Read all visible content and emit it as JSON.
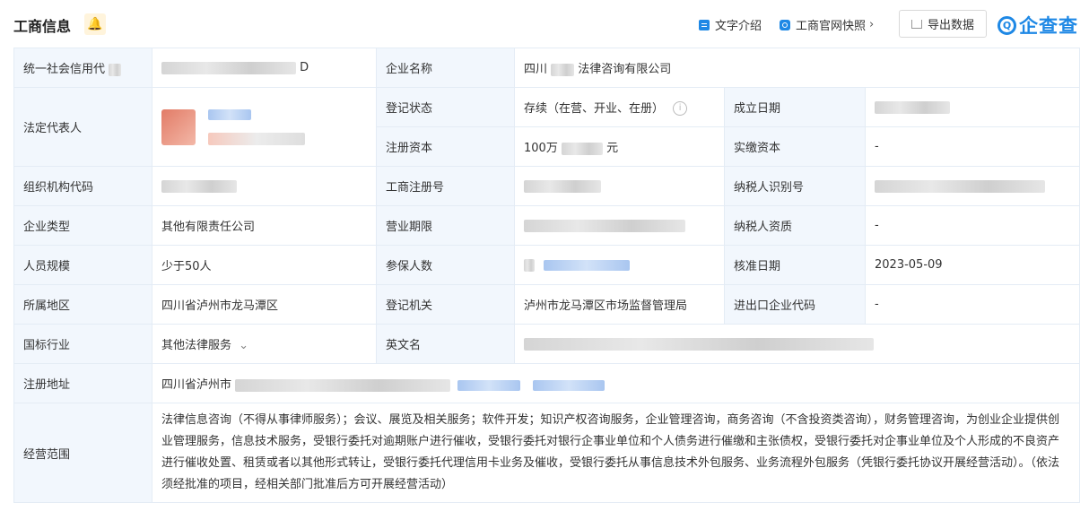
{
  "header": {
    "title": "工商信息",
    "text_intro": "文字介绍",
    "snapshot": "工商官网快照",
    "export": "导出数据",
    "logo_text": "企查查"
  },
  "colors": {
    "accent": "#1e88e5",
    "label_bg": "#f2f7fd",
    "border": "#e4ecf5"
  },
  "rows": {
    "credit_code_label": "统一社会信用代",
    "credit_code_value": "D",
    "company_name_label": "企业名称",
    "company_name_prefix": "四川",
    "company_name_suffix": "法律咨询有限公司",
    "legal_rep_label": "法定代表人",
    "reg_status_label": "登记状态",
    "reg_status_value": "存续（在营、开业、在册）",
    "est_date_label": "成立日期",
    "reg_capital_label": "注册资本",
    "reg_capital_value": "100万",
    "reg_capital_suffix": "元",
    "paid_capital_label": "实缴资本",
    "paid_capital_value": "-",
    "org_code_label": "组织机构代码",
    "biz_reg_no_label": "工商注册号",
    "taxpayer_id_label": "纳税人识别号",
    "company_type_label": "企业类型",
    "company_type_value": "其他有限责任公司",
    "biz_term_label": "营业期限",
    "taxpayer_qual_label": "纳税人资质",
    "taxpayer_qual_value": "-",
    "staff_size_label": "人员规模",
    "staff_size_value": "少于50人",
    "insured_label": "参保人数",
    "approve_date_label": "核准日期",
    "approve_date_value": "2023-05-09",
    "region_label": "所属地区",
    "region_value": "四川省泸州市龙马潭区",
    "reg_authority_label": "登记机关",
    "reg_authority_value": "泸州市龙马潭区市场监督管理局",
    "import_export_label": "进出口企业代码",
    "import_export_value": "-",
    "industry_label": "国标行业",
    "industry_value": "其他法律服务",
    "english_name_label": "英文名",
    "reg_address_label": "注册地址",
    "reg_address_prefix": "四川省泸州市",
    "biz_scope_label": "经营范围",
    "biz_scope_value": "法律信息咨询（不得从事律师服务）；会议、展览及相关服务；软件开发；知识产权咨询服务，企业管理咨询，商务咨询（不含投资类咨询），财务管理咨询，为创业企业提供创业管理服务，信息技术服务，受银行委托对逾期账户进行催收，受银行委托对银行企事业单位和个人债务进行催缴和主张债权，受银行委托对企事业单位及个人形成的不良资产进行催收处置、租赁或者以其他形式转让，受银行委托代理信用卡业务及催收，受银行委托从事信息技术外包服务、业务流程外包服务（凭银行委托协议开展经营活动）。（依法须经批准的项目，经相关部门批准后方可开展经营活动）"
  }
}
